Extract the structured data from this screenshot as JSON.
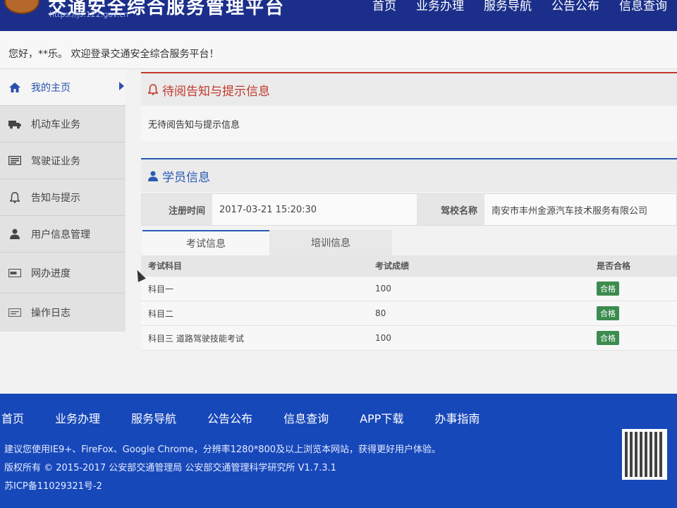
{
  "header": {
    "title": "交通安全综合服务管理平台",
    "url": "https://js.122.gov.cn",
    "nav": [
      "首页",
      "业务办理",
      "服务导航",
      "公告公布",
      "信息查询"
    ]
  },
  "welcome": "您好，**乐。 欢迎登录交通安全综合服务平台！",
  "sidebar": {
    "items": [
      {
        "label": "我的主页",
        "icon": "home-icon"
      },
      {
        "label": "机动车业务",
        "icon": "truck-icon"
      },
      {
        "label": "驾驶证业务",
        "icon": "card-icon"
      },
      {
        "label": "告知与提示",
        "icon": "bell-icon"
      },
      {
        "label": "用户信息管理",
        "icon": "user-icon"
      },
      {
        "label": "网办进度",
        "icon": "progress-icon"
      },
      {
        "label": "操作日志",
        "icon": "log-icon"
      }
    ]
  },
  "notice": {
    "title": "待阅告知与提示信息",
    "body": "无待阅告知与提示信息"
  },
  "student": {
    "title": "学员信息",
    "reg_label": "注册时间",
    "reg_value": "2017-03-21 15:20:30",
    "school_label": "驾校名称",
    "school_value": "南安市丰州金源汽车技术服务有限公司"
  },
  "tabs": [
    "考试信息",
    "培训信息"
  ],
  "exam_table": {
    "headers": [
      "考试科目",
      "考试成绩",
      "是否合格"
    ],
    "rows": [
      [
        "科目一",
        "100",
        "合格"
      ],
      [
        "科目二",
        "80",
        "合格"
      ],
      [
        "科目三 道路驾驶技能考试",
        "100",
        "合格"
      ]
    ]
  },
  "footer": {
    "nav": [
      "首页",
      "业务办理",
      "服务导航",
      "公告公布",
      "信息查询",
      "APP下载",
      "办事指南"
    ],
    "line1": "建议您使用IE9+、FireFox、Google Chrome，分辨率1280*800及以上浏览本网站，获得更好用户体验。",
    "line2": "版权所有 © 2015-2017 公安部交通管理局 公安部交通管理科学研究所 V1.7.3.1",
    "line3": "苏ICP备11029321号-2"
  },
  "colors": {
    "header": "#1b2f8a",
    "footer": "#1748ba",
    "accent_red": "#c0392b",
    "accent_blue": "#2a5ab4",
    "pass": "#3c8c4f"
  }
}
